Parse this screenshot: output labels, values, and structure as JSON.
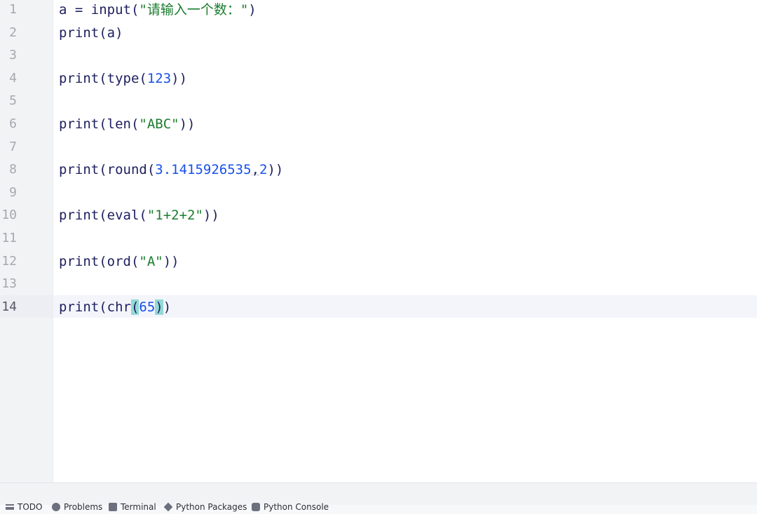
{
  "editor": {
    "line_numbers": [
      "1",
      "2",
      "3",
      "4",
      "5",
      "6",
      "7",
      "8",
      "9",
      "10",
      "11",
      "12",
      "13",
      "14"
    ],
    "current_line": 14,
    "lines": [
      [
        {
          "t": "a = input(",
          "c": "fn"
        },
        {
          "t": "\"请输入一个数：\"",
          "c": "str"
        },
        {
          "t": ")",
          "c": "fn"
        }
      ],
      [
        {
          "t": "print(a)",
          "c": "fn"
        }
      ],
      [],
      [
        {
          "t": "print(type(",
          "c": "fn"
        },
        {
          "t": "123",
          "c": "num"
        },
        {
          "t": "))",
          "c": "fn"
        }
      ],
      [],
      [
        {
          "t": "print(len(",
          "c": "fn"
        },
        {
          "t": "\"ABC\"",
          "c": "str"
        },
        {
          "t": "))",
          "c": "fn"
        }
      ],
      [],
      [
        {
          "t": "print(round(",
          "c": "fn"
        },
        {
          "t": "3.1415926535",
          "c": "num"
        },
        {
          "t": ",",
          "c": "fn comma-warn"
        },
        {
          "t": "2",
          "c": "num"
        },
        {
          "t": "))",
          "c": "fn"
        }
      ],
      [],
      [
        {
          "t": "print(eval(",
          "c": "fn"
        },
        {
          "t": "\"1+2+2\"",
          "c": "str"
        },
        {
          "t": "))",
          "c": "fn"
        }
      ],
      [],
      [
        {
          "t": "print(ord(",
          "c": "fn"
        },
        {
          "t": "\"A\"",
          "c": "str"
        },
        {
          "t": "))",
          "c": "fn"
        }
      ],
      [],
      [
        {
          "t": "print(chr",
          "c": "fn"
        },
        {
          "t": "(",
          "c": "fn brace-hl"
        },
        {
          "t": "65",
          "c": "num"
        },
        {
          "t": ")",
          "c": "fn brace-hl"
        },
        {
          "t": ")",
          "c": "fn"
        }
      ]
    ]
  },
  "bottombar": {
    "todo": "TODO",
    "problems": "Problems",
    "terminal": "Terminal",
    "python_packages": "Python Packages",
    "python_console": "Python Console"
  },
  "icons": [
    "todo-icon",
    "problems-icon",
    "terminal-icon",
    "packages-icon",
    "console-icon"
  ]
}
